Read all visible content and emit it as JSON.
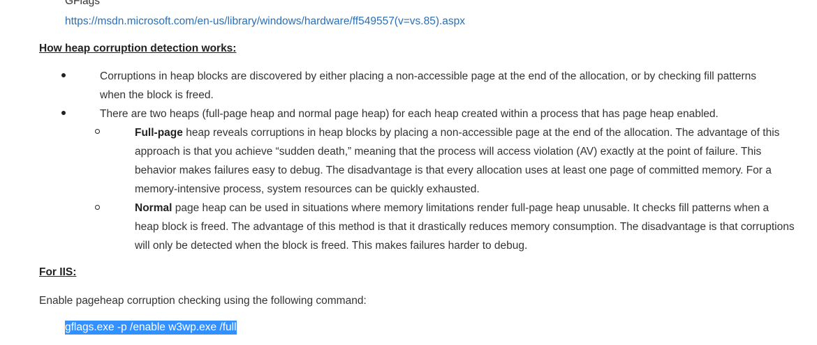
{
  "top_text": "GFlags",
  "link": "https://msdn.microsoft.com/en-us/library/windows/hardware/ff549557(v=vs.85).aspx",
  "section1": {
    "heading": "How heap corruption detection works:",
    "bullets": [
      "Corruptions in heap blocks are discovered by either placing a non-accessible page at the end of the allocation, or by checking fill patterns when the block is freed.",
      "There are two heaps (full-page heap and normal page heap) for each heap created within a process that has page heap enabled."
    ],
    "sub_bullets": [
      {
        "term": "Full-page",
        "text": " heap reveals corruptions in heap blocks by placing a non-accessible page at the end of the allocation. The advantage of this approach is that you achieve “sudden death,” meaning that the process will access violation (AV) exactly at the point of failure. This behavior makes failures easy to debug. The disadvantage is that every allocation uses at least one page of committed memory. For a memory-intensive process, system resources can be quickly exhausted."
      },
      {
        "term": "Normal",
        "text": " page heap can be used in situations where memory limitations render full-page heap unusable. It checks fill patterns when a heap block is freed. The advantage of this method is that it drastically reduces memory consumption. The disadvantage is that corruptions will only be detected when the block is freed. This makes failures harder to debug."
      }
    ]
  },
  "section2": {
    "heading": "For IIS:",
    "intro": "Enable pageheap corruption checking using the following command:",
    "command": "gflags.exe -p /enable w3wp.exe /full"
  }
}
